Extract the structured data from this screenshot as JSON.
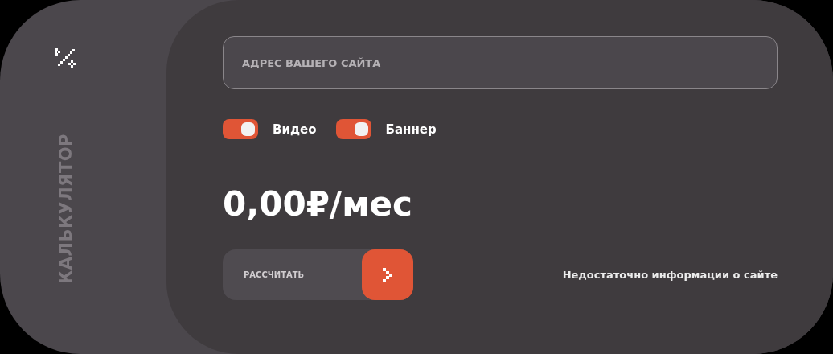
{
  "sidebar": {
    "title": "КАЛЬКУЛЯТОР"
  },
  "site_field": {
    "placeholder": "АДРЕС ВАШЕГО САЙТА"
  },
  "options": [
    {
      "label": "Видео",
      "on": true
    },
    {
      "label": "Баннер",
      "on": true
    }
  ],
  "price": "0,00₽/мес",
  "calculate_button": {
    "label": "РАССЧИТАТЬ"
  },
  "status": "Недостаточно информации о сайте"
}
